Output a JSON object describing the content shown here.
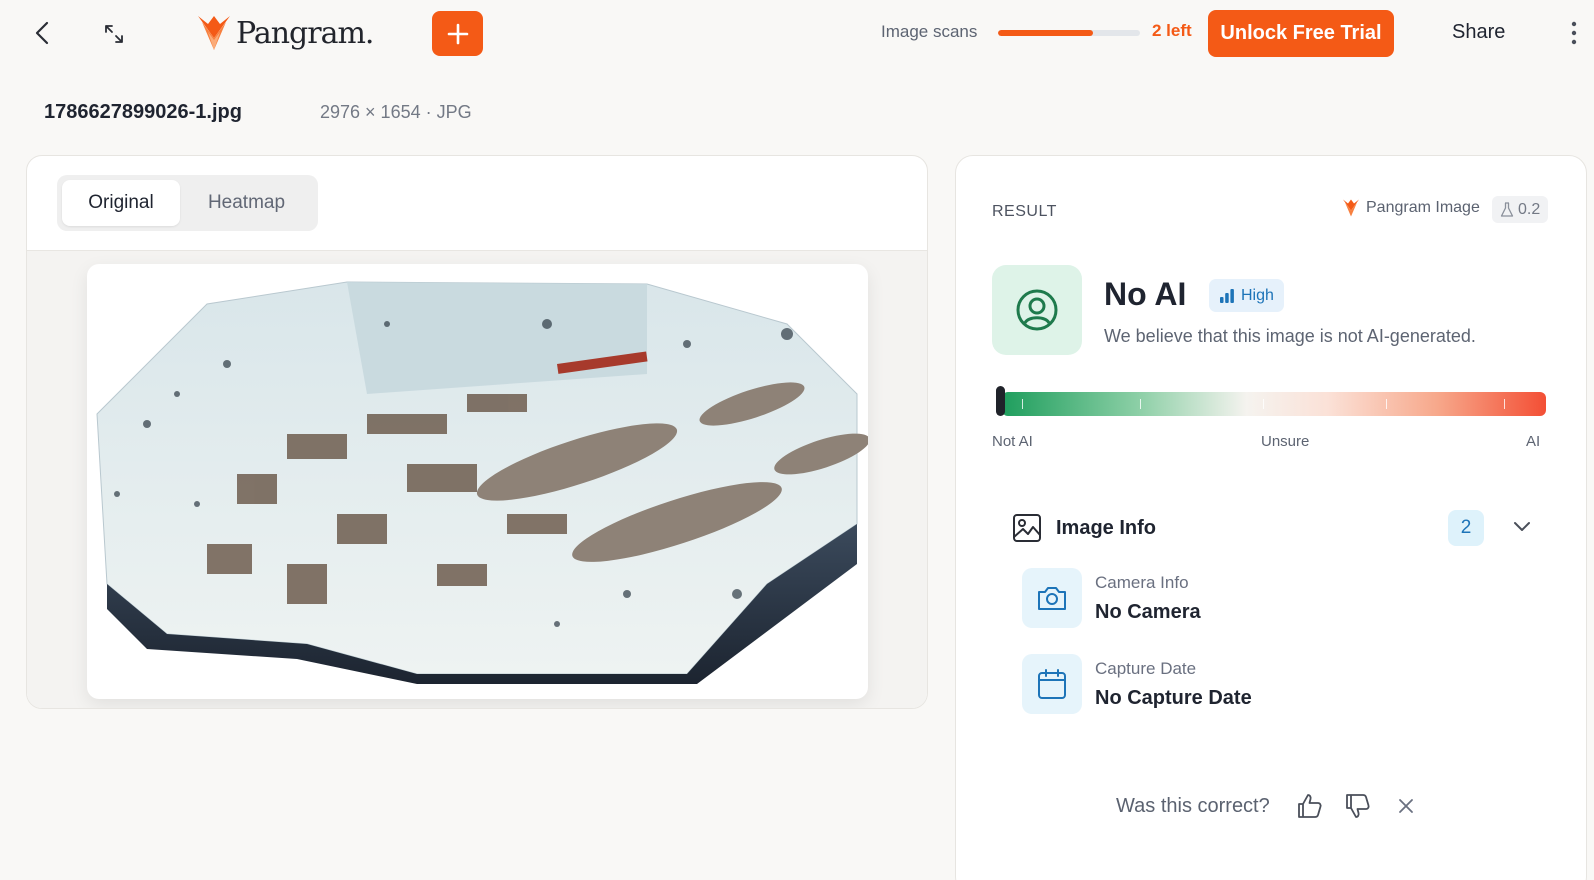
{
  "header": {
    "brand": "Pangram.",
    "scans_label": "Image scans",
    "scans_progress": 0.67,
    "scans_left": "2 left",
    "trial_label": "Unlock Free Trial",
    "share_label": "Share",
    "accent": "#f45a16"
  },
  "file": {
    "name": "1786627899026-1.jpg",
    "meta": "2976 × 1654 · JPG"
  },
  "viewer": {
    "tabs": [
      {
        "label": "Original",
        "active": true
      },
      {
        "label": "Heatmap",
        "active": false
      }
    ]
  },
  "result": {
    "section_label": "RESULT",
    "model_name": "Pangram Image",
    "model_version": "0.2",
    "verdict": "No AI",
    "confidence": "High",
    "description": "We believe that this image is not AI-generated.",
    "scale_position": 0.0,
    "scale_labels": [
      "Not AI",
      "Unsure",
      "AI"
    ],
    "verdict_color": "#1e9e5d"
  },
  "image_info": {
    "title": "Image Info",
    "count": "2",
    "rows": [
      {
        "label": "Camera Info",
        "value": "No Camera",
        "icon": "camera-icon"
      },
      {
        "label": "Capture Date",
        "value": "No Capture Date",
        "icon": "calendar-icon"
      }
    ]
  },
  "feedback": {
    "question": "Was this correct?"
  }
}
